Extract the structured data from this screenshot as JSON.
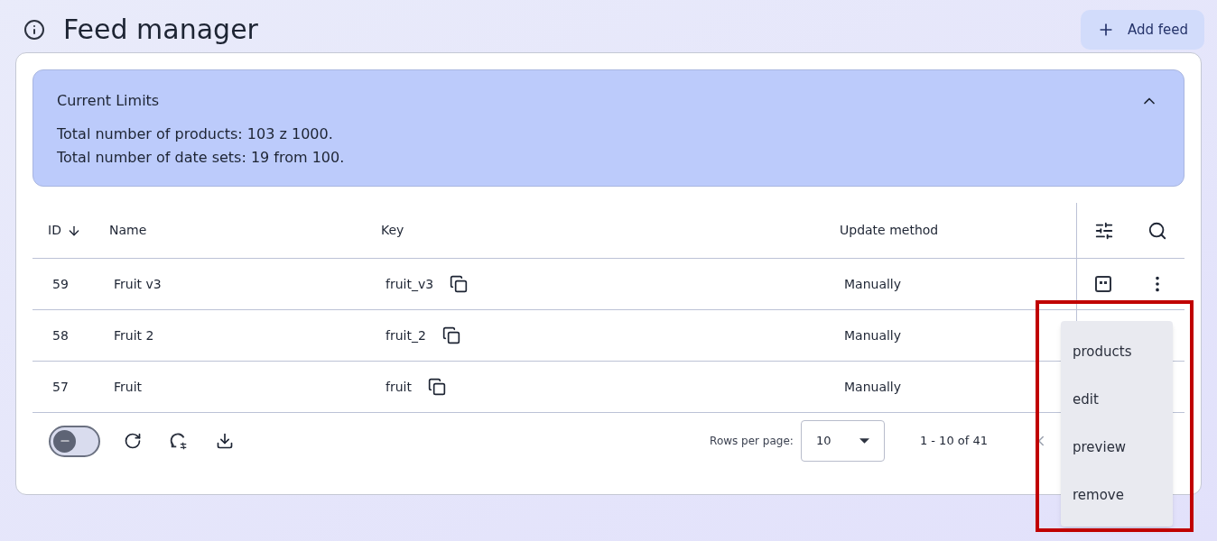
{
  "header": {
    "title": "Feed manager",
    "add_button": "Add feed"
  },
  "limits": {
    "title": "Current Limits",
    "expanded": true,
    "lines": [
      "Total number of products: 103 z 1000.",
      "Total number of date sets: 19 from 100."
    ]
  },
  "table": {
    "columns": [
      {
        "label": "ID",
        "sorted": true
      },
      {
        "label": "Name",
        "sorted": false
      },
      {
        "label": "Key",
        "sorted": false
      },
      {
        "label": "Update method",
        "sorted": false
      }
    ],
    "rows": [
      {
        "id": "59",
        "name": "Fruit v3",
        "key": "fruit_v3",
        "method": "Manually"
      },
      {
        "id": "58",
        "name": "Fruit 2",
        "key": "fruit_2",
        "method": "Manually"
      },
      {
        "id": "57",
        "name": "Fruit",
        "key": "fruit",
        "method": "Manually"
      }
    ]
  },
  "footer": {
    "toggle": {
      "on": false
    },
    "rows_per_page_label": "Rows per page:",
    "rows_per_page": "10",
    "range": "1 - 10 of 41"
  },
  "menu": {
    "items": [
      "products",
      "edit",
      "preview",
      "remove"
    ]
  }
}
